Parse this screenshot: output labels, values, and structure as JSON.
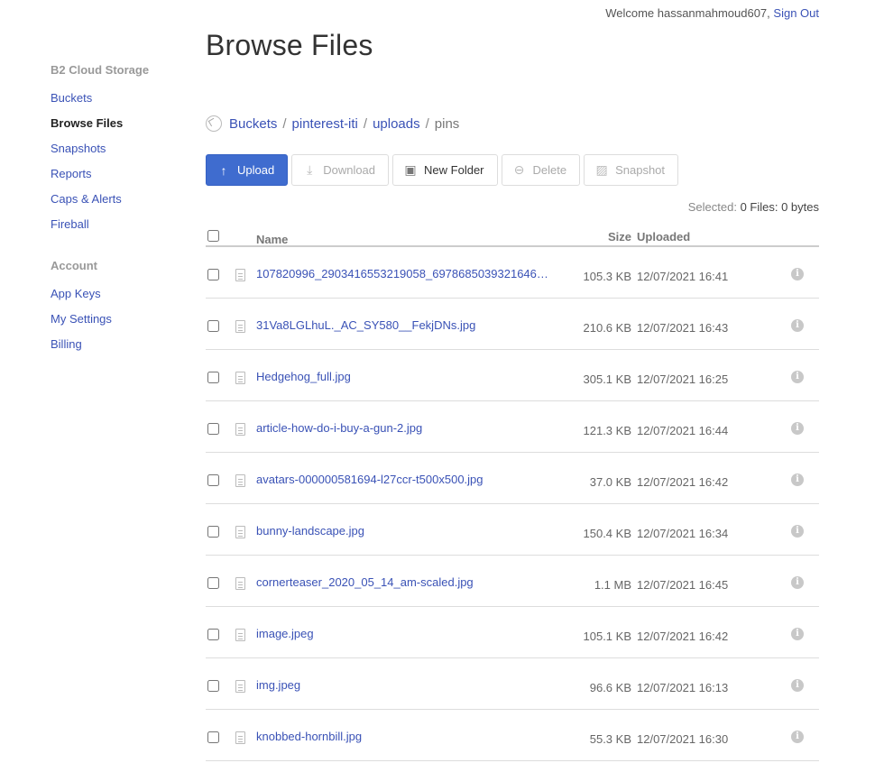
{
  "header": {
    "welcome_text": "Welcome hassanmahmoud607,",
    "sign_out": "Sign Out"
  },
  "sidebar": {
    "b2_heading": "B2 Cloud Storage",
    "b2_items": [
      "Buckets",
      "Browse Files",
      "Snapshots",
      "Reports",
      "Caps & Alerts",
      "Fireball"
    ],
    "active_item": "Browse Files",
    "account_heading": "Account",
    "account_items": [
      "App Keys",
      "My Settings",
      "Billing"
    ]
  },
  "main": {
    "title": "Browse Files",
    "breadcrumb": {
      "links": [
        "Buckets",
        "pinterest-iti",
        "uploads"
      ],
      "separator": "/",
      "current": "pins"
    },
    "toolbar": {
      "upload": "Upload",
      "download": "Download",
      "new_folder": "New Folder",
      "delete": "Delete",
      "snapshot": "Snapshot"
    },
    "selected": {
      "label": "Selected:",
      "value": "0 Files: 0 bytes"
    },
    "table": {
      "headers": {
        "name": "Name",
        "size": "Size",
        "uploaded": "Uploaded"
      },
      "rows": [
        {
          "name": "107820996_2903416553219058_6978685039321646…",
          "size": "105.3 KB",
          "uploaded": "12/07/2021 16:41"
        },
        {
          "name": "31Va8LGLhuL._AC_SY580__FekjDNs.jpg",
          "size": "210.6 KB",
          "uploaded": "12/07/2021 16:43"
        },
        {
          "name": "Hedgehog_full.jpg",
          "size": "305.1 KB",
          "uploaded": "12/07/2021 16:25"
        },
        {
          "name": "article-how-do-i-buy-a-gun-2.jpg",
          "size": "121.3 KB",
          "uploaded": "12/07/2021 16:44"
        },
        {
          "name": "avatars-000000581694-l27ccr-t500x500.jpg",
          "size": "37.0 KB",
          "uploaded": "12/07/2021 16:42"
        },
        {
          "name": "bunny-landscape.jpg",
          "size": "150.4 KB",
          "uploaded": "12/07/2021 16:34"
        },
        {
          "name": "cornerteaser_2020_05_14_am-scaled.jpg",
          "size": "1.1 MB",
          "uploaded": "12/07/2021 16:45"
        },
        {
          "name": "image.jpeg",
          "size": "105.1 KB",
          "uploaded": "12/07/2021 16:42"
        },
        {
          "name": "img.jpeg",
          "size": "96.6 KB",
          "uploaded": "12/07/2021 16:13"
        },
        {
          "name": "knobbed-hornbill.jpg",
          "size": "55.3 KB",
          "uploaded": "12/07/2021 16:30"
        }
      ]
    }
  },
  "colors": {
    "link": "#3a52b6",
    "primary_button": "#3f6ccf"
  }
}
